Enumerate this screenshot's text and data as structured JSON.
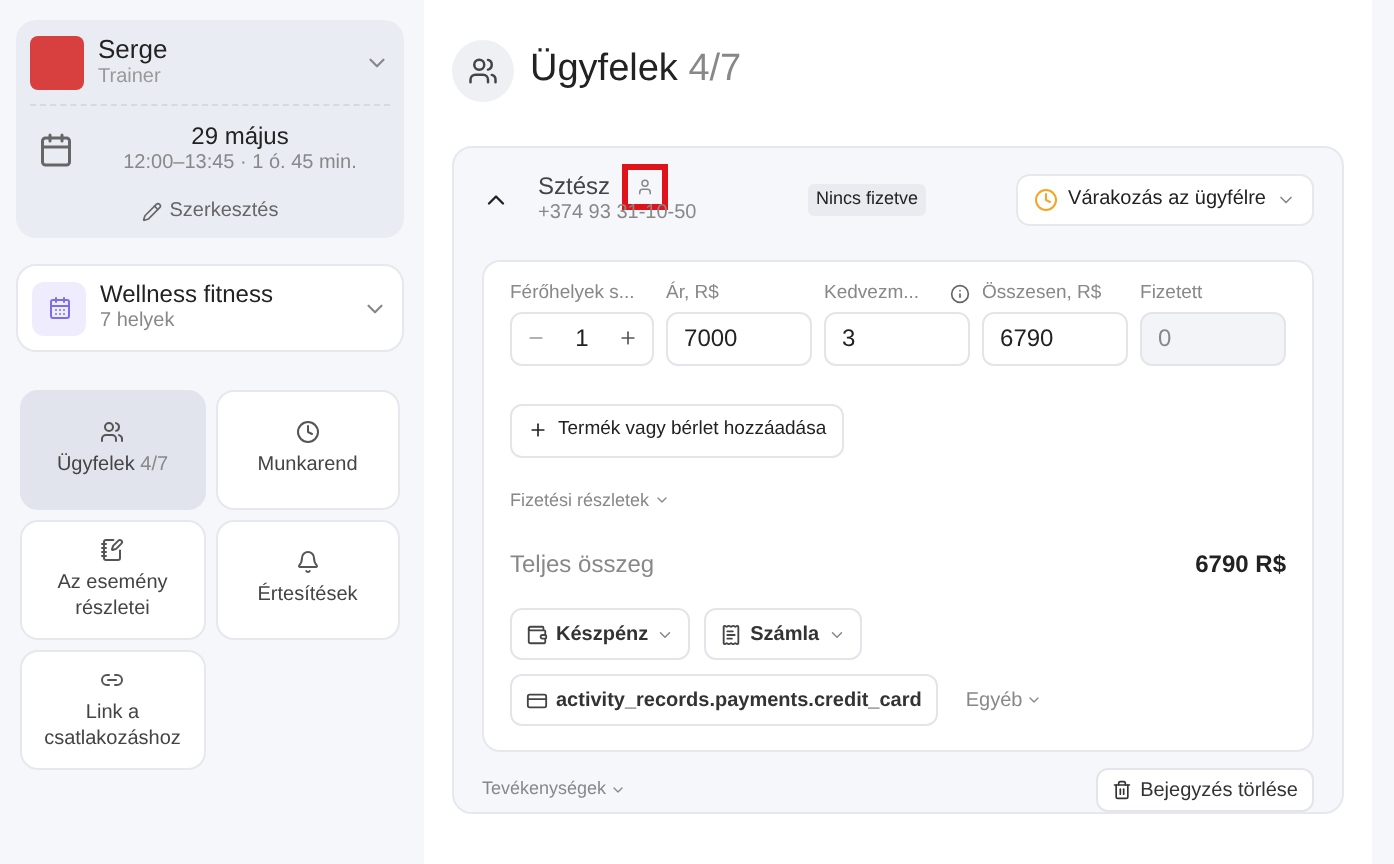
{
  "sidebar": {
    "trainer": {
      "name": "Serge",
      "role": "Trainer"
    },
    "date": "29 május",
    "time": "12:00–13:45 · 1 ó. 45 min.",
    "edit_label": "Szerkesztés",
    "location": {
      "name": "Wellness fitness",
      "places": "7 helyek"
    },
    "nav": [
      {
        "label": "Ügyfelek",
        "count": "4/7",
        "kind": "users",
        "selected": true
      },
      {
        "label": "Munkarend",
        "kind": "clock",
        "selected": false
      },
      {
        "label": "Az esemény részletei",
        "kind": "note",
        "selected": false
      },
      {
        "label": "Értesítések",
        "kind": "bell",
        "selected": false
      },
      {
        "label": "Link a csatlakozáshoz",
        "kind": "link",
        "selected": false
      }
    ]
  },
  "main": {
    "title": "Ügyfelek",
    "count": "4/7",
    "client": {
      "name": "Sztész",
      "phone": "+374 93 31-10-50",
      "expanded": true,
      "highlighted": true,
      "payment_badge": "Nincs fizetve",
      "status": "Várakozás az ügyfélre",
      "fields": [
        {
          "label": "Férőhelyek s...",
          "value": "1",
          "kind": "stepper"
        },
        {
          "label": "Ár, R$",
          "value": "7000",
          "kind": "input"
        },
        {
          "label": "Kedvezm...",
          "value": "3",
          "kind": "input",
          "info": true
        },
        {
          "label": "Összesen, R$",
          "value": "6790",
          "kind": "input"
        },
        {
          "label": "Fizetett",
          "value": "0",
          "kind": "readonly"
        }
      ],
      "add_button": "Termék vagy bérlet hozzáadása",
      "payment_details": "Fizetési részletek",
      "total_label": "Teljes összeg",
      "total_value": "6790 R$",
      "payment_buttons": [
        {
          "label": "Készpénz",
          "kind": "wallet"
        },
        {
          "label": "Számla",
          "kind": "invoice"
        }
      ],
      "card_button": "activity_records.payments.credit_card",
      "other": "Egyéb"
    },
    "activities": "Tevékenységek",
    "delete_button": "Bejegyzés törlése"
  }
}
